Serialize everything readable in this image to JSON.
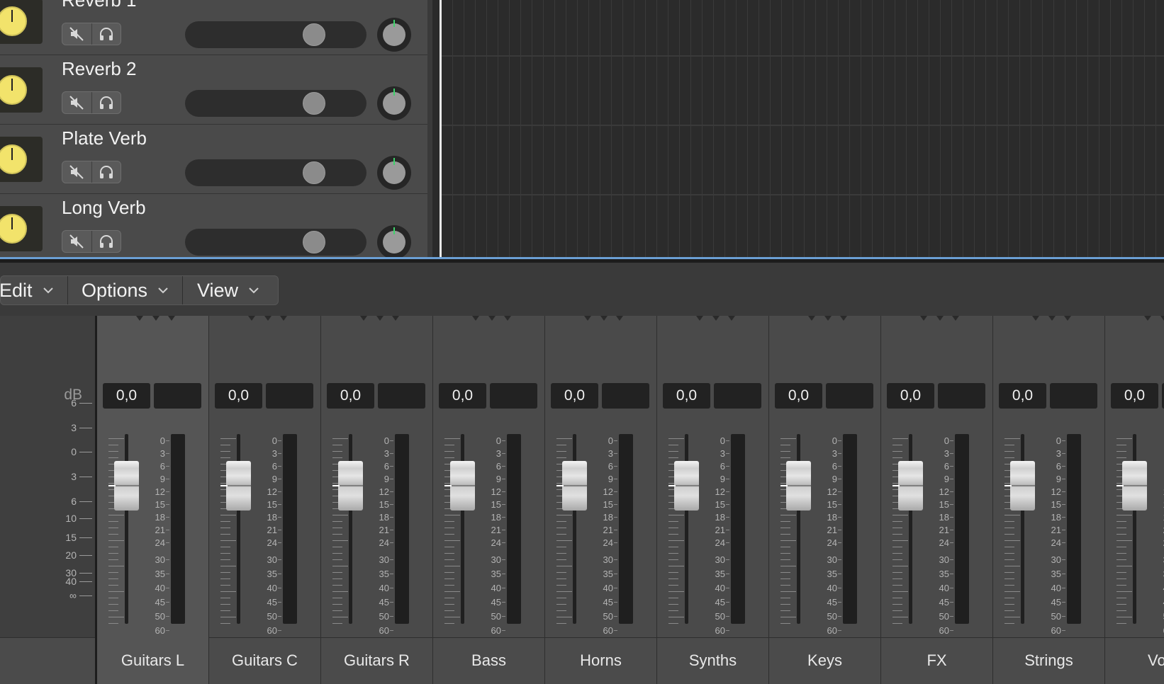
{
  "tracks": [
    {
      "name": "Reverb 1"
    },
    {
      "name": "Reverb 2"
    },
    {
      "name": "Plate Verb"
    },
    {
      "name": "Long Verb"
    }
  ],
  "toolbar": {
    "edit_label": "Edit",
    "options_label": "Options",
    "view_label": "View"
  },
  "mixer": {
    "db_label": "dB",
    "left_scale": [
      "6",
      "3",
      "0",
      "3",
      "6",
      "10",
      "15",
      "20",
      "30",
      "40",
      "∞"
    ],
    "meter_scale": [
      "0",
      "3",
      "6",
      "9",
      "12",
      "15",
      "18",
      "21",
      "24",
      "30",
      "35",
      "40",
      "45",
      "50",
      "60"
    ],
    "mute_label": "M",
    "solo_label": "S",
    "channels": [
      {
        "name": "Guitars L",
        "value": "0,0"
      },
      {
        "name": "Guitars C",
        "value": "0,0"
      },
      {
        "name": "Guitars R",
        "value": "0,0"
      },
      {
        "name": "Bass",
        "value": "0,0"
      },
      {
        "name": "Horns",
        "value": "0,0"
      },
      {
        "name": "Synths",
        "value": "0,0"
      },
      {
        "name": "Keys",
        "value": "0,0"
      },
      {
        "name": "FX",
        "value": "0,0"
      },
      {
        "name": "Strings",
        "value": "0,0"
      },
      {
        "name": "Vo",
        "value": "0,0"
      }
    ]
  },
  "colors": {
    "accent_blue": "#6b9fd4",
    "knob_yellow": "#f2e36b",
    "pan_indicator": "#3fd36b"
  }
}
